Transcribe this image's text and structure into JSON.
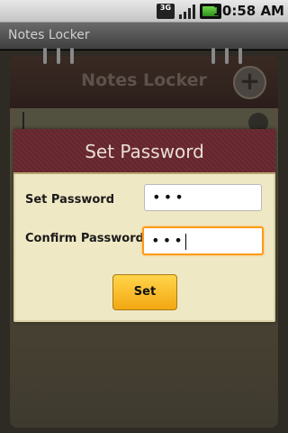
{
  "status_bar": {
    "network_label": "3G",
    "time": "10:58",
    "time_suffix": "AM",
    "icons": [
      "network-3g-icon",
      "signal-icon",
      "battery-icon"
    ]
  },
  "app": {
    "title": "Notes Locker"
  },
  "notebook": {
    "title": "Notes Locker",
    "add_label": "+"
  },
  "dialog": {
    "title": "Set Password",
    "fields": [
      {
        "label": "Set Password",
        "value": "•••"
      },
      {
        "label": "Confirm Password",
        "value": "•••"
      }
    ],
    "set_button": "Set"
  },
  "colors": {
    "dialog_header": "#6e2c34",
    "dialog_body": "#efe8c4",
    "button": "#f3a712",
    "focus": "#ff9a1a"
  }
}
